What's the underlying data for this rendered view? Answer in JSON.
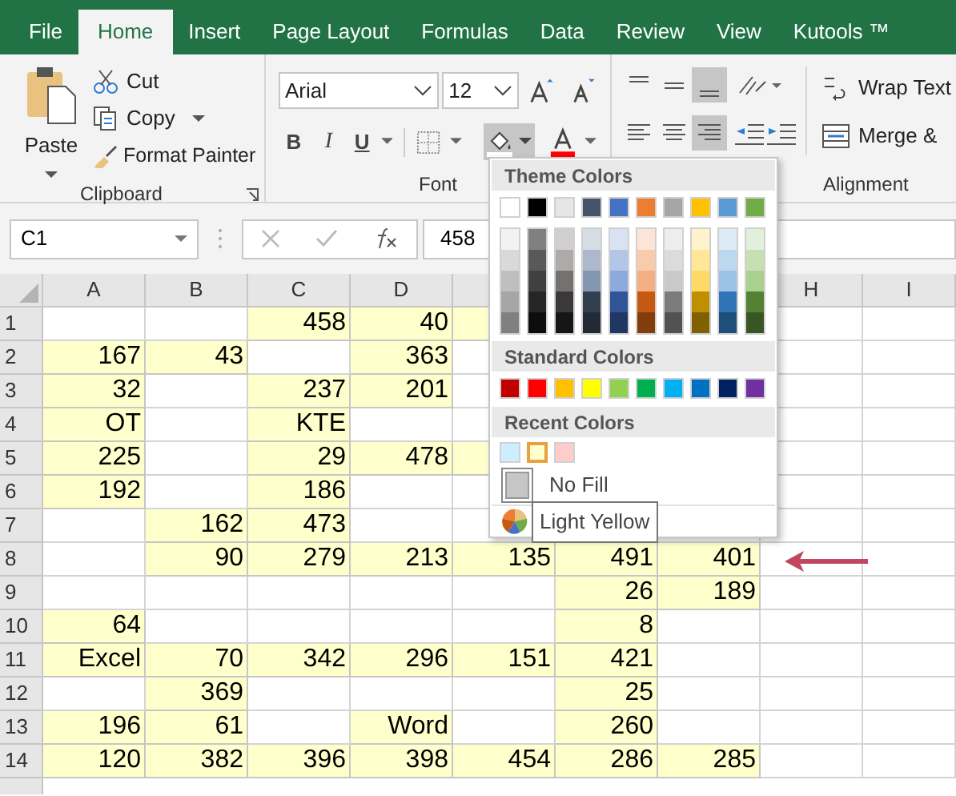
{
  "ribbon": {
    "tabs": [
      {
        "label": "File",
        "selected": false
      },
      {
        "label": "Home",
        "selected": true
      },
      {
        "label": "Insert",
        "selected": false
      },
      {
        "label": "Page Layout",
        "selected": false
      },
      {
        "label": "Formulas",
        "selected": false
      },
      {
        "label": "Data",
        "selected": false
      },
      {
        "label": "Review",
        "selected": false
      },
      {
        "label": "View",
        "selected": false
      },
      {
        "label": "Kutools ™",
        "selected": false
      }
    ],
    "clipboard": {
      "paste": "Paste",
      "cut": "Cut",
      "copy": "Copy",
      "format_painter": "Format Painter",
      "label": "Clipboard"
    },
    "font": {
      "font_name": "Arial",
      "font_size": "12",
      "label": "Font",
      "bold": "B",
      "italic": "I",
      "underline": "U"
    },
    "alignment": {
      "wrap_text": "Wrap Text",
      "merge": "Merge &",
      "label": "Alignment"
    }
  },
  "formula_bar": {
    "name_box": "C1",
    "value": "458"
  },
  "sheet": {
    "columns": [
      "A",
      "B",
      "C",
      "D"
    ],
    "columns_right": [
      "H",
      "I"
    ],
    "rows": [
      {
        "label": "1",
        "cells": [
          {
            "highlighted": false
          },
          {
            "highlighted": false
          },
          {
            "value": "458",
            "highlighted": true
          },
          {
            "value": "40",
            "highlighted": true
          },
          {
            "highlighted": true
          }
        ]
      },
      {
        "label": "2",
        "cells": [
          {
            "value": "167",
            "highlighted": true
          },
          {
            "value": "43",
            "highlighted": true
          },
          {
            "highlighted": false
          },
          {
            "value": "363",
            "highlighted": true
          },
          {
            "highlighted": false
          }
        ]
      },
      {
        "label": "3",
        "cells": [
          {
            "value": "32",
            "highlighted": true
          },
          {
            "highlighted": false
          },
          {
            "value": "237",
            "highlighted": true
          },
          {
            "value": "201",
            "highlighted": true
          },
          {
            "highlighted": false
          }
        ]
      },
      {
        "label": "4",
        "cells": [
          {
            "value": "OT",
            "highlighted": true
          },
          {
            "highlighted": false
          },
          {
            "value": "KTE",
            "highlighted": true
          },
          {
            "highlighted": false
          },
          {
            "highlighted": false
          }
        ]
      },
      {
        "label": "5",
        "cells": [
          {
            "value": "225",
            "highlighted": true
          },
          {
            "highlighted": false
          },
          {
            "value": "29",
            "highlighted": true
          },
          {
            "value": "478",
            "highlighted": true
          },
          {
            "highlighted": true
          }
        ]
      },
      {
        "label": "6",
        "cells": [
          {
            "value": "192",
            "highlighted": true
          },
          {
            "highlighted": false
          },
          {
            "value": "186",
            "highlighted": true
          },
          {
            "highlighted": false
          },
          {
            "highlighted": false
          }
        ]
      },
      {
        "label": "7",
        "cells": [
          {
            "highlighted": false
          },
          {
            "value": "162",
            "highlighted": true
          },
          {
            "value": "473",
            "highlighted": true
          },
          {
            "highlighted": false
          },
          {
            "highlighted": false
          }
        ]
      },
      {
        "label": "8",
        "cells": [
          {
            "highlighted": false
          },
          {
            "value": "90",
            "highlighted": true
          },
          {
            "value": "279",
            "highlighted": true
          },
          {
            "value": "213",
            "highlighted": true
          },
          {
            "value": "135",
            "highlighted": true
          },
          {
            "value": "491",
            "highlighted": true
          },
          {
            "value": "401",
            "highlighted": true
          }
        ]
      },
      {
        "label": "9",
        "cells": [
          {
            "highlighted": false
          },
          {
            "highlighted": false
          },
          {
            "highlighted": false
          },
          {
            "highlighted": false
          },
          {
            "highlighted": false
          },
          {
            "value": "26",
            "highlighted": true
          },
          {
            "value": "189",
            "highlighted": true
          }
        ]
      },
      {
        "label": "10",
        "cells": [
          {
            "value": "64",
            "highlighted": true
          },
          {
            "highlighted": false
          },
          {
            "highlighted": false
          },
          {
            "highlighted": false
          },
          {
            "highlighted": false
          },
          {
            "value": "8",
            "highlighted": true
          },
          {
            "highlighted": false
          }
        ]
      },
      {
        "label": "11",
        "cells": [
          {
            "value": "Excel",
            "highlighted": true
          },
          {
            "value": "70",
            "highlighted": true
          },
          {
            "value": "342",
            "highlighted": true
          },
          {
            "value": "296",
            "highlighted": true
          },
          {
            "value": "151",
            "highlighted": true
          },
          {
            "value": "421",
            "highlighted": true
          },
          {
            "highlighted": false
          }
        ]
      },
      {
        "label": "12",
        "cells": [
          {
            "highlighted": false
          },
          {
            "value": "369",
            "highlighted": true
          },
          {
            "highlighted": false
          },
          {
            "highlighted": false
          },
          {
            "highlighted": false
          },
          {
            "value": "25",
            "highlighted": true
          },
          {
            "highlighted": false
          }
        ]
      },
      {
        "label": "13",
        "cells": [
          {
            "value": "196",
            "highlighted": true
          },
          {
            "value": "61",
            "highlighted": true
          },
          {
            "highlighted": false
          },
          {
            "value": "Word",
            "highlighted": true
          },
          {
            "highlighted": false
          },
          {
            "value": "260",
            "highlighted": true
          },
          {
            "highlighted": false
          }
        ]
      },
      {
        "label": "14",
        "cells": [
          {
            "value": "120",
            "highlighted": true
          },
          {
            "value": "382",
            "highlighted": true
          },
          {
            "value": "396",
            "highlighted": true
          },
          {
            "value": "398",
            "highlighted": true
          },
          {
            "value": "454",
            "highlighted": true
          },
          {
            "value": "286",
            "highlighted": true
          },
          {
            "value": "285",
            "highlighted": true
          }
        ]
      }
    ]
  },
  "fill_color_menu": {
    "theme_header": "Theme Colors",
    "theme_colors": [
      {
        "color": "#ffffff",
        "shades": [
          {
            "color": "#f2f2f2"
          },
          {
            "color": "#d9d9d9"
          },
          {
            "color": "#bfbfbf"
          },
          {
            "color": "#a6a6a6"
          },
          {
            "color": "#808080"
          }
        ]
      },
      {
        "color": "#000000",
        "shades": [
          {
            "color": "#808080"
          },
          {
            "color": "#595959"
          },
          {
            "color": "#404040"
          },
          {
            "color": "#262626"
          },
          {
            "color": "#0d0d0d"
          }
        ]
      },
      {
        "color": "#e7e6e6",
        "shades": [
          {
            "color": "#d0cece"
          },
          {
            "color": "#aeaaaa"
          },
          {
            "color": "#757171"
          },
          {
            "color": "#3a3838"
          },
          {
            "color": "#171616"
          }
        ]
      },
      {
        "color": "#44546a",
        "shades": [
          {
            "color": "#d6dce4"
          },
          {
            "color": "#adb9ca"
          },
          {
            "color": "#8497b0"
          },
          {
            "color": "#333f4f"
          },
          {
            "color": "#222a35"
          }
        ]
      },
      {
        "color": "#4472c4",
        "shades": [
          {
            "color": "#d9e1f2"
          },
          {
            "color": "#b4c6e7"
          },
          {
            "color": "#8ea9db"
          },
          {
            "color": "#305496"
          },
          {
            "color": "#203764"
          }
        ]
      },
      {
        "color": "#ed7d31",
        "shades": [
          {
            "color": "#fce4d6"
          },
          {
            "color": "#f8cbad"
          },
          {
            "color": "#f4b084"
          },
          {
            "color": "#c65911"
          },
          {
            "color": "#833c0c"
          }
        ]
      },
      {
        "color": "#a5a5a5",
        "shades": [
          {
            "color": "#ededed"
          },
          {
            "color": "#dbdbdb"
          },
          {
            "color": "#c9c9c9"
          },
          {
            "color": "#7b7b7b"
          },
          {
            "color": "#525252"
          }
        ]
      },
      {
        "color": "#ffc000",
        "shades": [
          {
            "color": "#fff2cc"
          },
          {
            "color": "#ffe699"
          },
          {
            "color": "#ffd966"
          },
          {
            "color": "#bf8f00"
          },
          {
            "color": "#806000"
          }
        ]
      },
      {
        "color": "#5b9bd5",
        "shades": [
          {
            "color": "#ddebf7"
          },
          {
            "color": "#bdd7ee"
          },
          {
            "color": "#9bc2e6"
          },
          {
            "color": "#2f75b5"
          },
          {
            "color": "#1f4e78"
          }
        ]
      },
      {
        "color": "#70ad47",
        "shades": [
          {
            "color": "#e2efda"
          },
          {
            "color": "#c6e0b4"
          },
          {
            "color": "#a9d08e"
          },
          {
            "color": "#548235"
          },
          {
            "color": "#375623"
          }
        ]
      }
    ],
    "standard_header": "Standard Colors",
    "standard_colors": [
      {
        "color": "#c00000"
      },
      {
        "color": "#ff0000"
      },
      {
        "color": "#ffc000"
      },
      {
        "color": "#ffff00"
      },
      {
        "color": "#92d050"
      },
      {
        "color": "#00b050"
      },
      {
        "color": "#00b0f0"
      },
      {
        "color": "#0070c0"
      },
      {
        "color": "#002060"
      },
      {
        "color": "#7030a0"
      }
    ],
    "recent_header": "Recent Colors",
    "recent_colors": [
      {
        "color": "#cceeff",
        "selected": false
      },
      {
        "color": "#ffffcc",
        "selected": true
      },
      {
        "color": "#ffcccc",
        "selected": false
      }
    ],
    "no_fill": "No Fill",
    "tooltip": "Light Yellow"
  }
}
